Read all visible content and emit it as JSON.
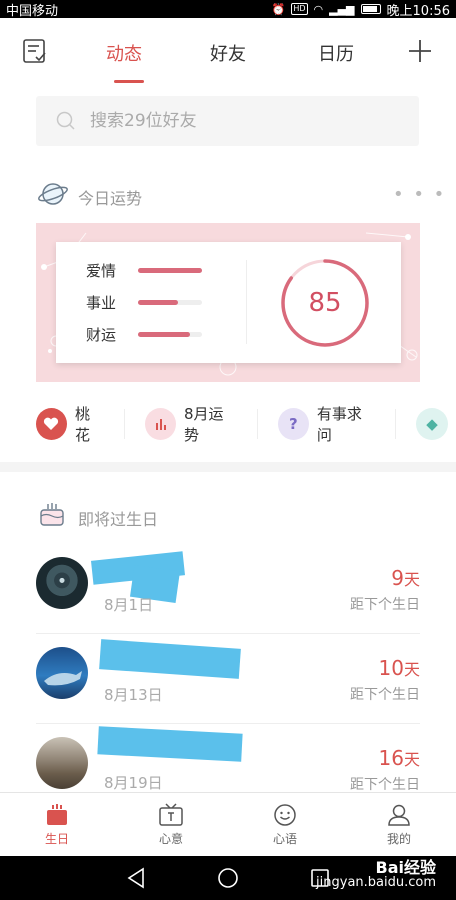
{
  "status_bar": {
    "carrier": "中国移动",
    "time": "晚上10:56",
    "hd": "HD"
  },
  "header": {
    "tabs": [
      {
        "label": "动态",
        "active": true
      },
      {
        "label": "好友",
        "active": false
      },
      {
        "label": "日历",
        "active": false
      }
    ]
  },
  "search": {
    "placeholder": "搜索29位好友"
  },
  "fortune": {
    "title": "今日运势",
    "more": "• • •",
    "items": [
      {
        "label": "爱情",
        "value": 1.0
      },
      {
        "label": "事业",
        "value": 0.62
      },
      {
        "label": "财运",
        "value": 0.82
      }
    ],
    "score": "85",
    "score_value": 85
  },
  "quick_links": [
    {
      "label": "桃花",
      "icon": "heart-icon"
    },
    {
      "label": "8月运势",
      "icon": "bar-chart-icon"
    },
    {
      "label": "有事求问",
      "icon": "question-icon"
    }
  ],
  "birthdays": {
    "title": "即将过生日",
    "caption": "距下个生日",
    "unit": "天",
    "items": [
      {
        "date": "8月1日",
        "days": "9"
      },
      {
        "date": "8月13日",
        "days": "10"
      },
      {
        "date": "8月19日",
        "days": "16"
      }
    ]
  },
  "bottom_nav": [
    {
      "label": "生日",
      "active": true,
      "icon": "cake-icon"
    },
    {
      "label": "心意",
      "active": false,
      "icon": "gift-tv-icon"
    },
    {
      "label": "心语",
      "active": false,
      "icon": "smile-icon"
    },
    {
      "label": "我的",
      "active": false,
      "icon": "person-icon"
    }
  ],
  "watermark": {
    "brand": "Bai经验",
    "url": "jingyan.baidu.com"
  },
  "colors": {
    "accent": "#d9534f",
    "fortune_bg": "#f7dadd",
    "redaction": "#5bc0eb"
  }
}
